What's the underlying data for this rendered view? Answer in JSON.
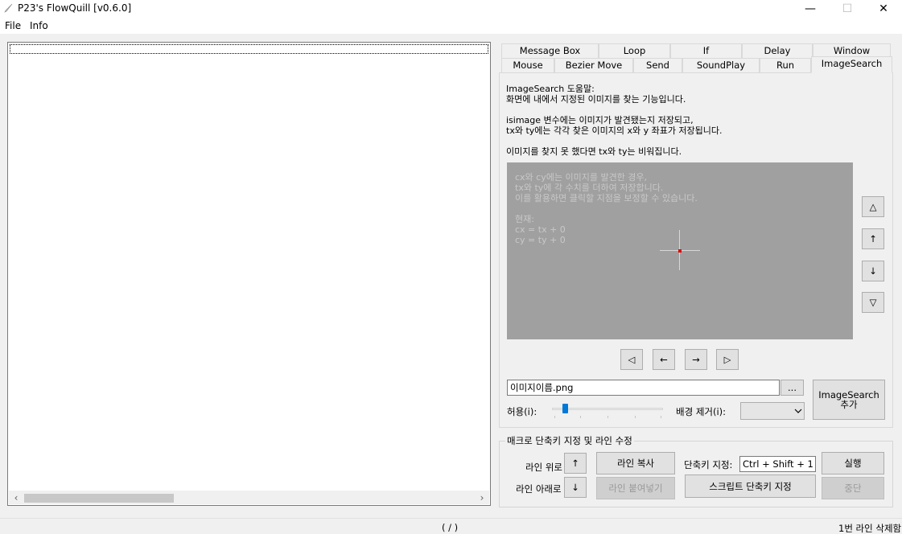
{
  "window": {
    "title": "P23's FlowQuill [v0.6.0]",
    "minimize": "—",
    "maximize": "☐",
    "close": "✕"
  },
  "menu": {
    "file": "File",
    "info": "Info"
  },
  "tabs": {
    "row1": [
      "Message Box",
      "Loop",
      "If",
      "Delay",
      "Window"
    ],
    "row2": [
      "Mouse",
      "Bezier Move",
      "Send",
      "SoundPlay",
      "Run"
    ],
    "active": "ImageSearch"
  },
  "help": {
    "line1": "ImageSearch 도움말:",
    "line2": "화면에 내에서 지정된 이미지를 찾는 기능입니다.",
    "line3": "isimage 변수에는 이미지가 발견됐는지 저장되고,",
    "line4": "tx와 ty에는 각각 찾은 이미지의 x와 y 좌표가 저장됩니다.",
    "line5": "이미지를 찾지 못 했다면 tx와 ty는 비워집니다."
  },
  "preview": {
    "line1": "cx와 cy에는 이미지를 발견한 경우,",
    "line2": "tx와 ty에 각 수치를 더하여 저장합니다.",
    "line3": "이를 활용하면 클릭할 지점을 보정할 수 있습니다.",
    "line4": "현재:",
    "line5": "cx = tx + 0",
    "line6": "cy = ty + 0"
  },
  "arrows": {
    "up_big": "△",
    "up": "↑",
    "down": "↓",
    "down_big": "▽",
    "left_big": "◁",
    "left": "←",
    "right": "→",
    "right_big": "▷"
  },
  "image_name": "이미지이름.png",
  "browse": "...",
  "add_button": "ImageSearch 추가",
  "tolerance_label": "허용(i):",
  "tolerance_value": 0.1,
  "bg_remove_label": "배경 제거(i):",
  "bg_remove_value": "",
  "group": {
    "title": "매크로 단축키 지정 및 라인 수정",
    "line_up_label": "라인 위로",
    "line_down_label": "라인 아래로",
    "up_arrow": "↑",
    "down_arrow": "↓",
    "copy_line": "라인 복사",
    "paste_line": "라인 붙여넣기",
    "hotkey_label": "단축키 지정:",
    "hotkey_value": "Ctrl + Shift + 1",
    "script_hotkey": "스크립트 단축키 지정",
    "run": "실행",
    "stop": "중단"
  },
  "status": {
    "center": "( / )",
    "right": "1번 라인 삭제함"
  }
}
